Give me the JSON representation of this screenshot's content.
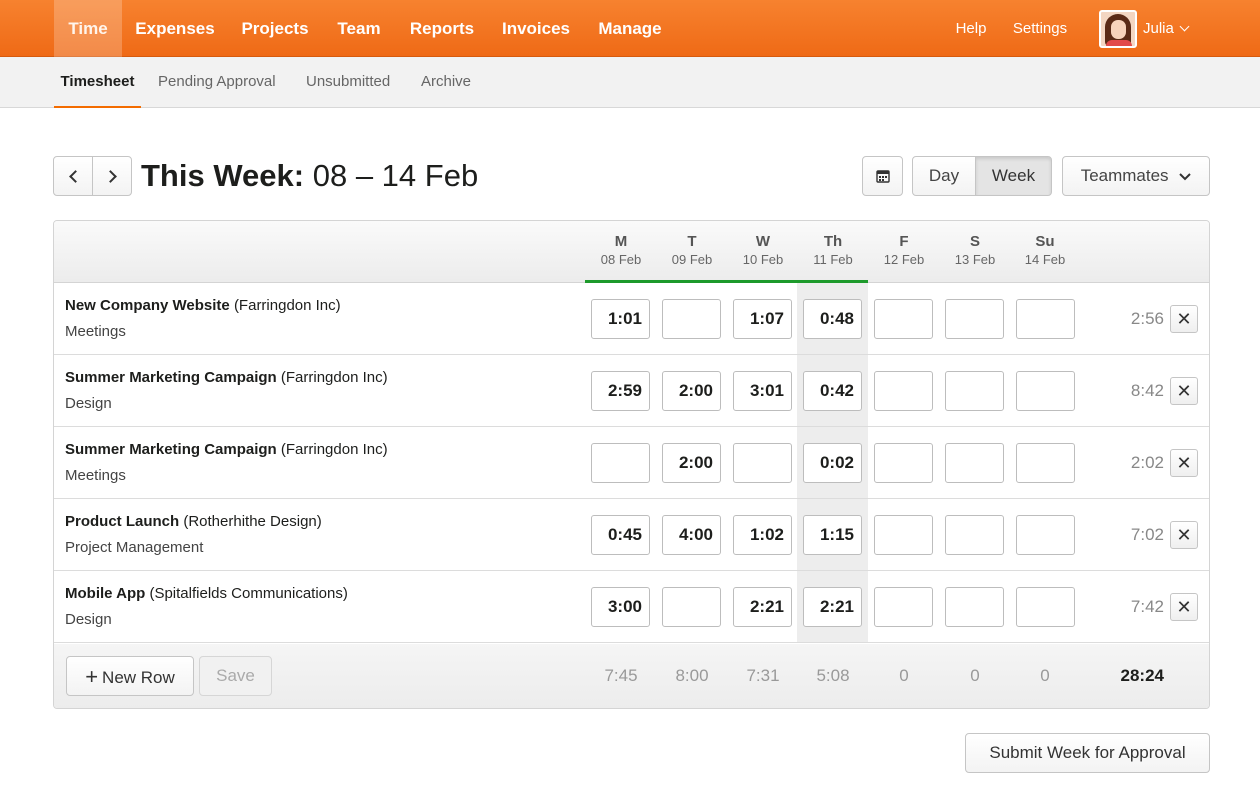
{
  "topnav": {
    "items": [
      "Time",
      "Expenses",
      "Projects",
      "Team",
      "Reports",
      "Invoices",
      "Manage"
    ],
    "active": "Time",
    "help": "Help",
    "settings": "Settings",
    "user": "Julia",
    "user_caret_icon": "chevron-down-icon",
    "brand_color": "#f36c00"
  },
  "subnav": {
    "items": [
      "Timesheet",
      "Pending Approval",
      "Unsubmitted",
      "Archive"
    ],
    "active": "Timesheet"
  },
  "week": {
    "prev_icon": "chevron-left-icon",
    "next_icon": "chevron-right-icon",
    "title_bold": "This Week:",
    "title_range": "08 – 14 Feb",
    "calendar_icon": "calendar-icon",
    "view_day": "Day",
    "view_week": "Week",
    "active_view": "Week",
    "teammates": "Teammates"
  },
  "table": {
    "days": [
      {
        "d": "M",
        "date": "08 Feb"
      },
      {
        "d": "T",
        "date": "09 Feb"
      },
      {
        "d": "W",
        "date": "10 Feb"
      },
      {
        "d": "Th",
        "date": "11 Feb"
      },
      {
        "d": "F",
        "date": "12 Feb"
      },
      {
        "d": "S",
        "date": "13 Feb"
      },
      {
        "d": "Su",
        "date": "14 Feb"
      }
    ],
    "rows": [
      {
        "project": "New Company Website",
        "client": "(Farringdon Inc)",
        "task": "Meetings",
        "hours": [
          "1:01",
          "",
          "1:07",
          "0:48",
          "",
          "",
          ""
        ],
        "total": "2:56"
      },
      {
        "project": "Summer Marketing Campaign",
        "client": "(Farringdon Inc)",
        "task": "Design",
        "hours": [
          "2:59",
          "2:00",
          "3:01",
          "0:42",
          "",
          "",
          ""
        ],
        "total": "8:42"
      },
      {
        "project": "Summer Marketing Campaign",
        "client": "(Farringdon Inc)",
        "task": "Meetings",
        "hours": [
          "",
          "2:00",
          "",
          "0:02",
          "",
          "",
          ""
        ],
        "total": "2:02"
      },
      {
        "project": "Product Launch",
        "client": "(Rotherhithe Design)",
        "task": "Project Management",
        "hours": [
          "0:45",
          "4:00",
          "1:02",
          "1:15",
          "",
          "",
          ""
        ],
        "total": "7:02"
      },
      {
        "project": "Mobile App",
        "client": "(Spitalfields Communications)",
        "task": "Design",
        "hours": [
          "3:00",
          "",
          "2:21",
          "2:21",
          "",
          "",
          ""
        ],
        "total": "7:42"
      }
    ],
    "delete_icon": "close-icon",
    "day_totals": [
      "7:45",
      "8:00",
      "7:31",
      "5:08",
      "0",
      "0",
      "0"
    ],
    "grand_total": "28:24",
    "new_row": "New Row",
    "new_row_icon": "plus-icon",
    "save": "Save",
    "today_color": "#1d9a2b"
  },
  "submit": "Submit Week for Approval"
}
